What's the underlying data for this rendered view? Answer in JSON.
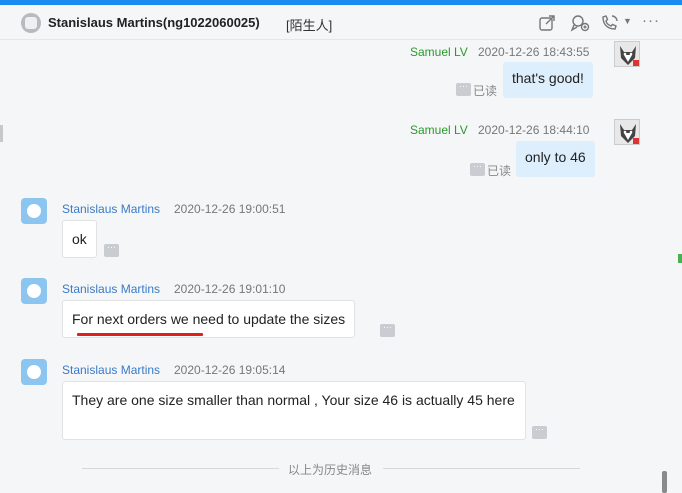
{
  "header": {
    "title": "Stanislaus Martins(ng1022060025)",
    "tag": "[陌生人]",
    "icons": [
      "share-icon",
      "add-contact-icon",
      "call-icon",
      "dropdown-caret-icon",
      "more-icon"
    ]
  },
  "messages": [
    {
      "sender": "Samuel LV",
      "time": "2020-12-26 18:43:55",
      "text": "that's good!",
      "status": "已读",
      "direction": "outgoing"
    },
    {
      "sender": "Samuel LV",
      "time": "2020-12-26 18:44:10",
      "text": "only to 46",
      "status": "已读",
      "direction": "outgoing"
    },
    {
      "sender": "Stanislaus Martins",
      "time": "2020-12-26 19:00:51",
      "text": "ok",
      "direction": "incoming"
    },
    {
      "sender": "Stanislaus Martins",
      "time": "2020-12-26 19:01:10",
      "text": "For next orders we need to update the sizes",
      "direction": "incoming",
      "annotation": "red-underline"
    },
    {
      "sender": "Stanislaus Martins",
      "time": "2020-12-26 19:05:14",
      "text": "They are one size smaller than normal , Your size 46 is actually 45 here",
      "direction": "incoming"
    }
  ],
  "more_button_label": "···",
  "history_divider": "以上为历史消息",
  "colors": {
    "accent_top_bar": "#1a8cf0",
    "self_name": "#2a9a2a",
    "other_name": "#3a7ac8",
    "self_bubble": "#ddeefc",
    "annotation": "#e0201c"
  }
}
